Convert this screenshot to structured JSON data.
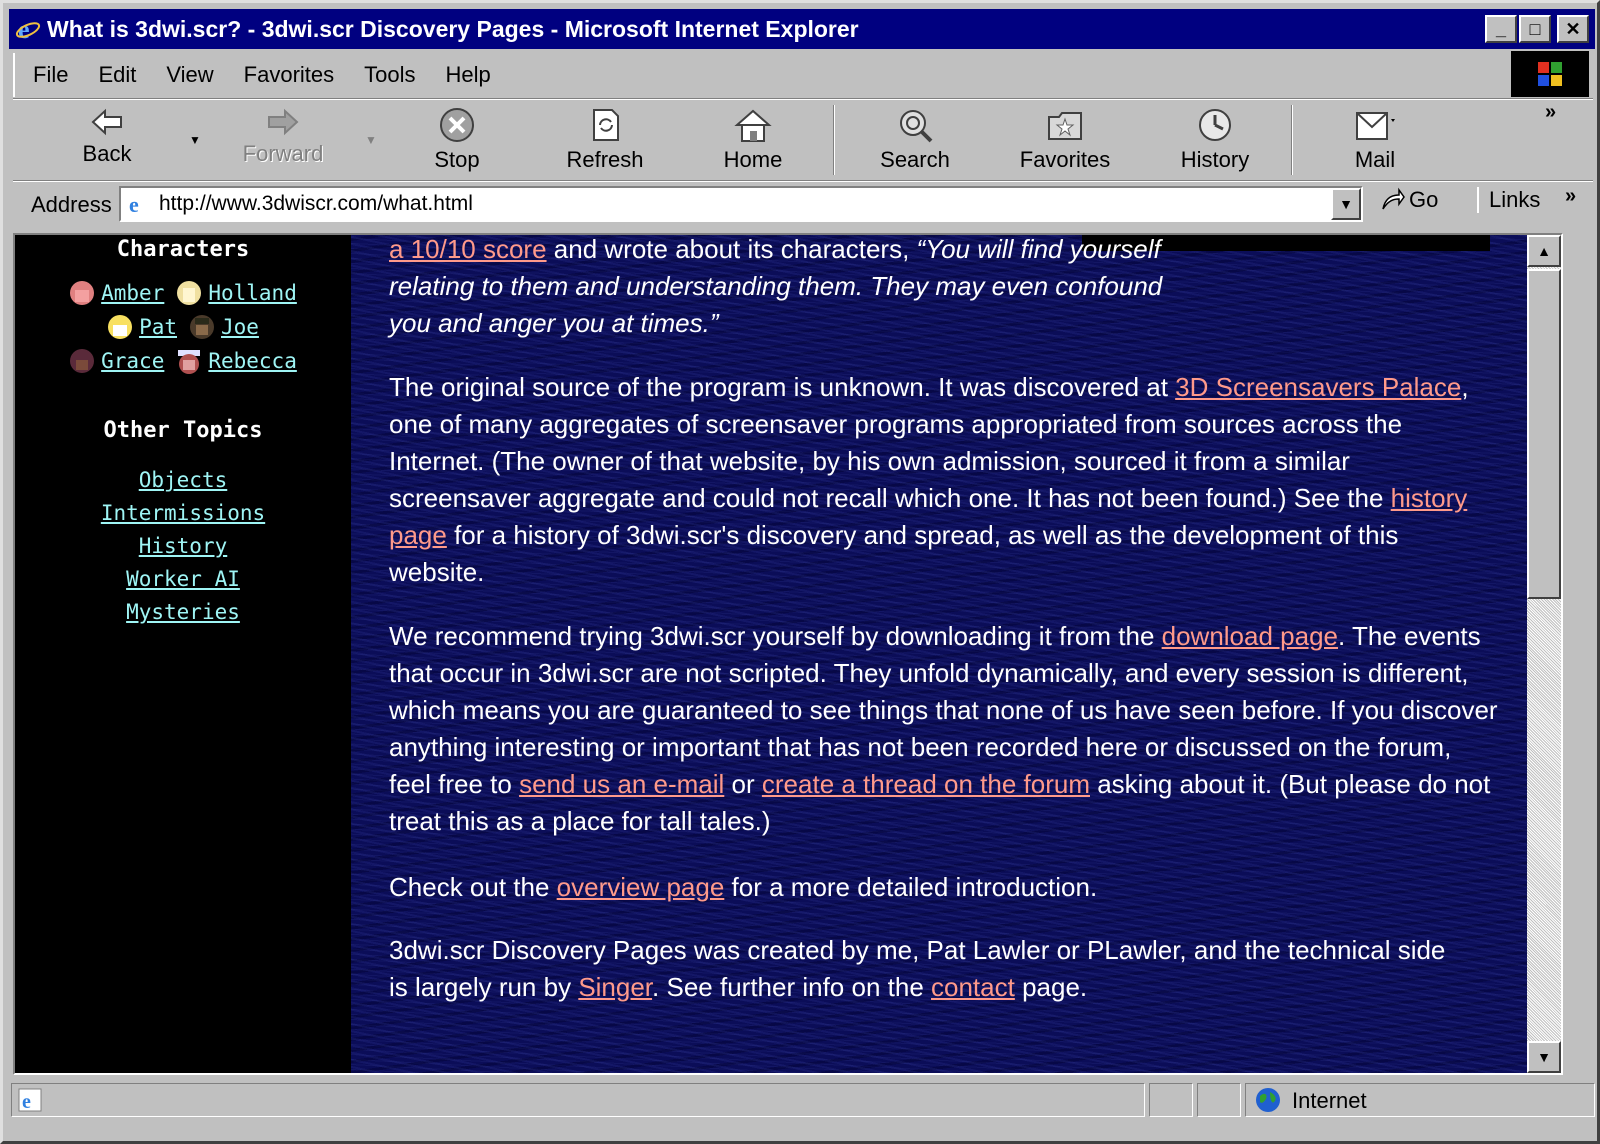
{
  "window": {
    "title": "What is 3dwi.scr? - 3dwi.scr Discovery Pages - Microsoft Internet Explorer",
    "minimize": "_",
    "maximize": "□",
    "close": "✕"
  },
  "menu": {
    "file": "File",
    "edit": "Edit",
    "view": "View",
    "favorites": "Favorites",
    "tools": "Tools",
    "help": "Help"
  },
  "toolbar": {
    "back": "Back",
    "forward": "Forward",
    "stop": "Stop",
    "refresh": "Refresh",
    "home": "Home",
    "search": "Search",
    "favorites": "Favorites",
    "history": "History",
    "mail": "Mail"
  },
  "address": {
    "label": "Address",
    "url": "http://www.3dwiscr.com/what.html",
    "go": "Go",
    "links": "Links"
  },
  "sidebar": {
    "characters_heading": "Characters",
    "characters": [
      {
        "name": "Amber",
        "color": "#e08080"
      },
      {
        "name": "Holland",
        "color": "#f0e0a0"
      },
      {
        "name": "Pat",
        "color": "#f8e060"
      },
      {
        "name": "Joe",
        "color": "#4a3a2a"
      },
      {
        "name": "Grace",
        "color": "#5a2a3a"
      },
      {
        "name": "Rebecca",
        "color": "#b05050"
      }
    ],
    "topics_heading": "Other Topics",
    "topics": [
      "Objects",
      "Intermissions",
      "History",
      "Worker AI",
      "Mysteries"
    ]
  },
  "main": {
    "p1": {
      "link_score": "a 10/10 score",
      "text_a": " and wrote about its characters, ",
      "quote": "“You will find yourself relating to them and understanding them. They may even confound you and anger you at times.”"
    },
    "p2": {
      "t1": "The original source of the program is unknown. It was discovered at ",
      "link_palace": "3D Screensavers Palace",
      "t2": ", one of many aggregates of screensaver programs appropriated from sources across the Internet. (The owner of that website, by his own admission, sourced it from a similar screensaver aggregate and could not recall which one. It has not been found.) See the ",
      "link_history": "history page",
      "t3": " for a history of 3dwi.scr's discovery and spread, as well as the development of this website."
    },
    "p3": {
      "t1": "We recommend trying 3dwi.scr yourself by downloading it from the ",
      "link_download": "download page",
      "t2": ". The events that occur in 3dwi.scr are not scripted. They unfold dynamically, and every session is different, which means you are guaranteed to see things that none of us have seen before. If you discover anything interesting or important that has not been recorded here or discussed on the forum, feel free to ",
      "link_email": "send us an e-mail",
      "t3": " or ",
      "link_thread": "create a thread on the forum",
      "t4": " asking about it. (But please do not treat this as a place for tall tales.)"
    },
    "p4": {
      "t1": "Check out the ",
      "link_overview": "overview page",
      "t2": " for a more detailed introduction."
    },
    "p5": {
      "t1": "3dwi.scr Discovery Pages was created by me, Pat Lawler or PLawler, and the technical side is largely run by ",
      "link_singer": "Singer",
      "t2": ". See further info on the ",
      "link_contact": "contact",
      "t3": " page."
    }
  },
  "status": {
    "zone": "Internet"
  },
  "colors": {
    "titlebar": "#000080",
    "link": "#ff9a8a",
    "sidebar_link": "#9ff5f5",
    "main_bg": "#0b0d58"
  }
}
